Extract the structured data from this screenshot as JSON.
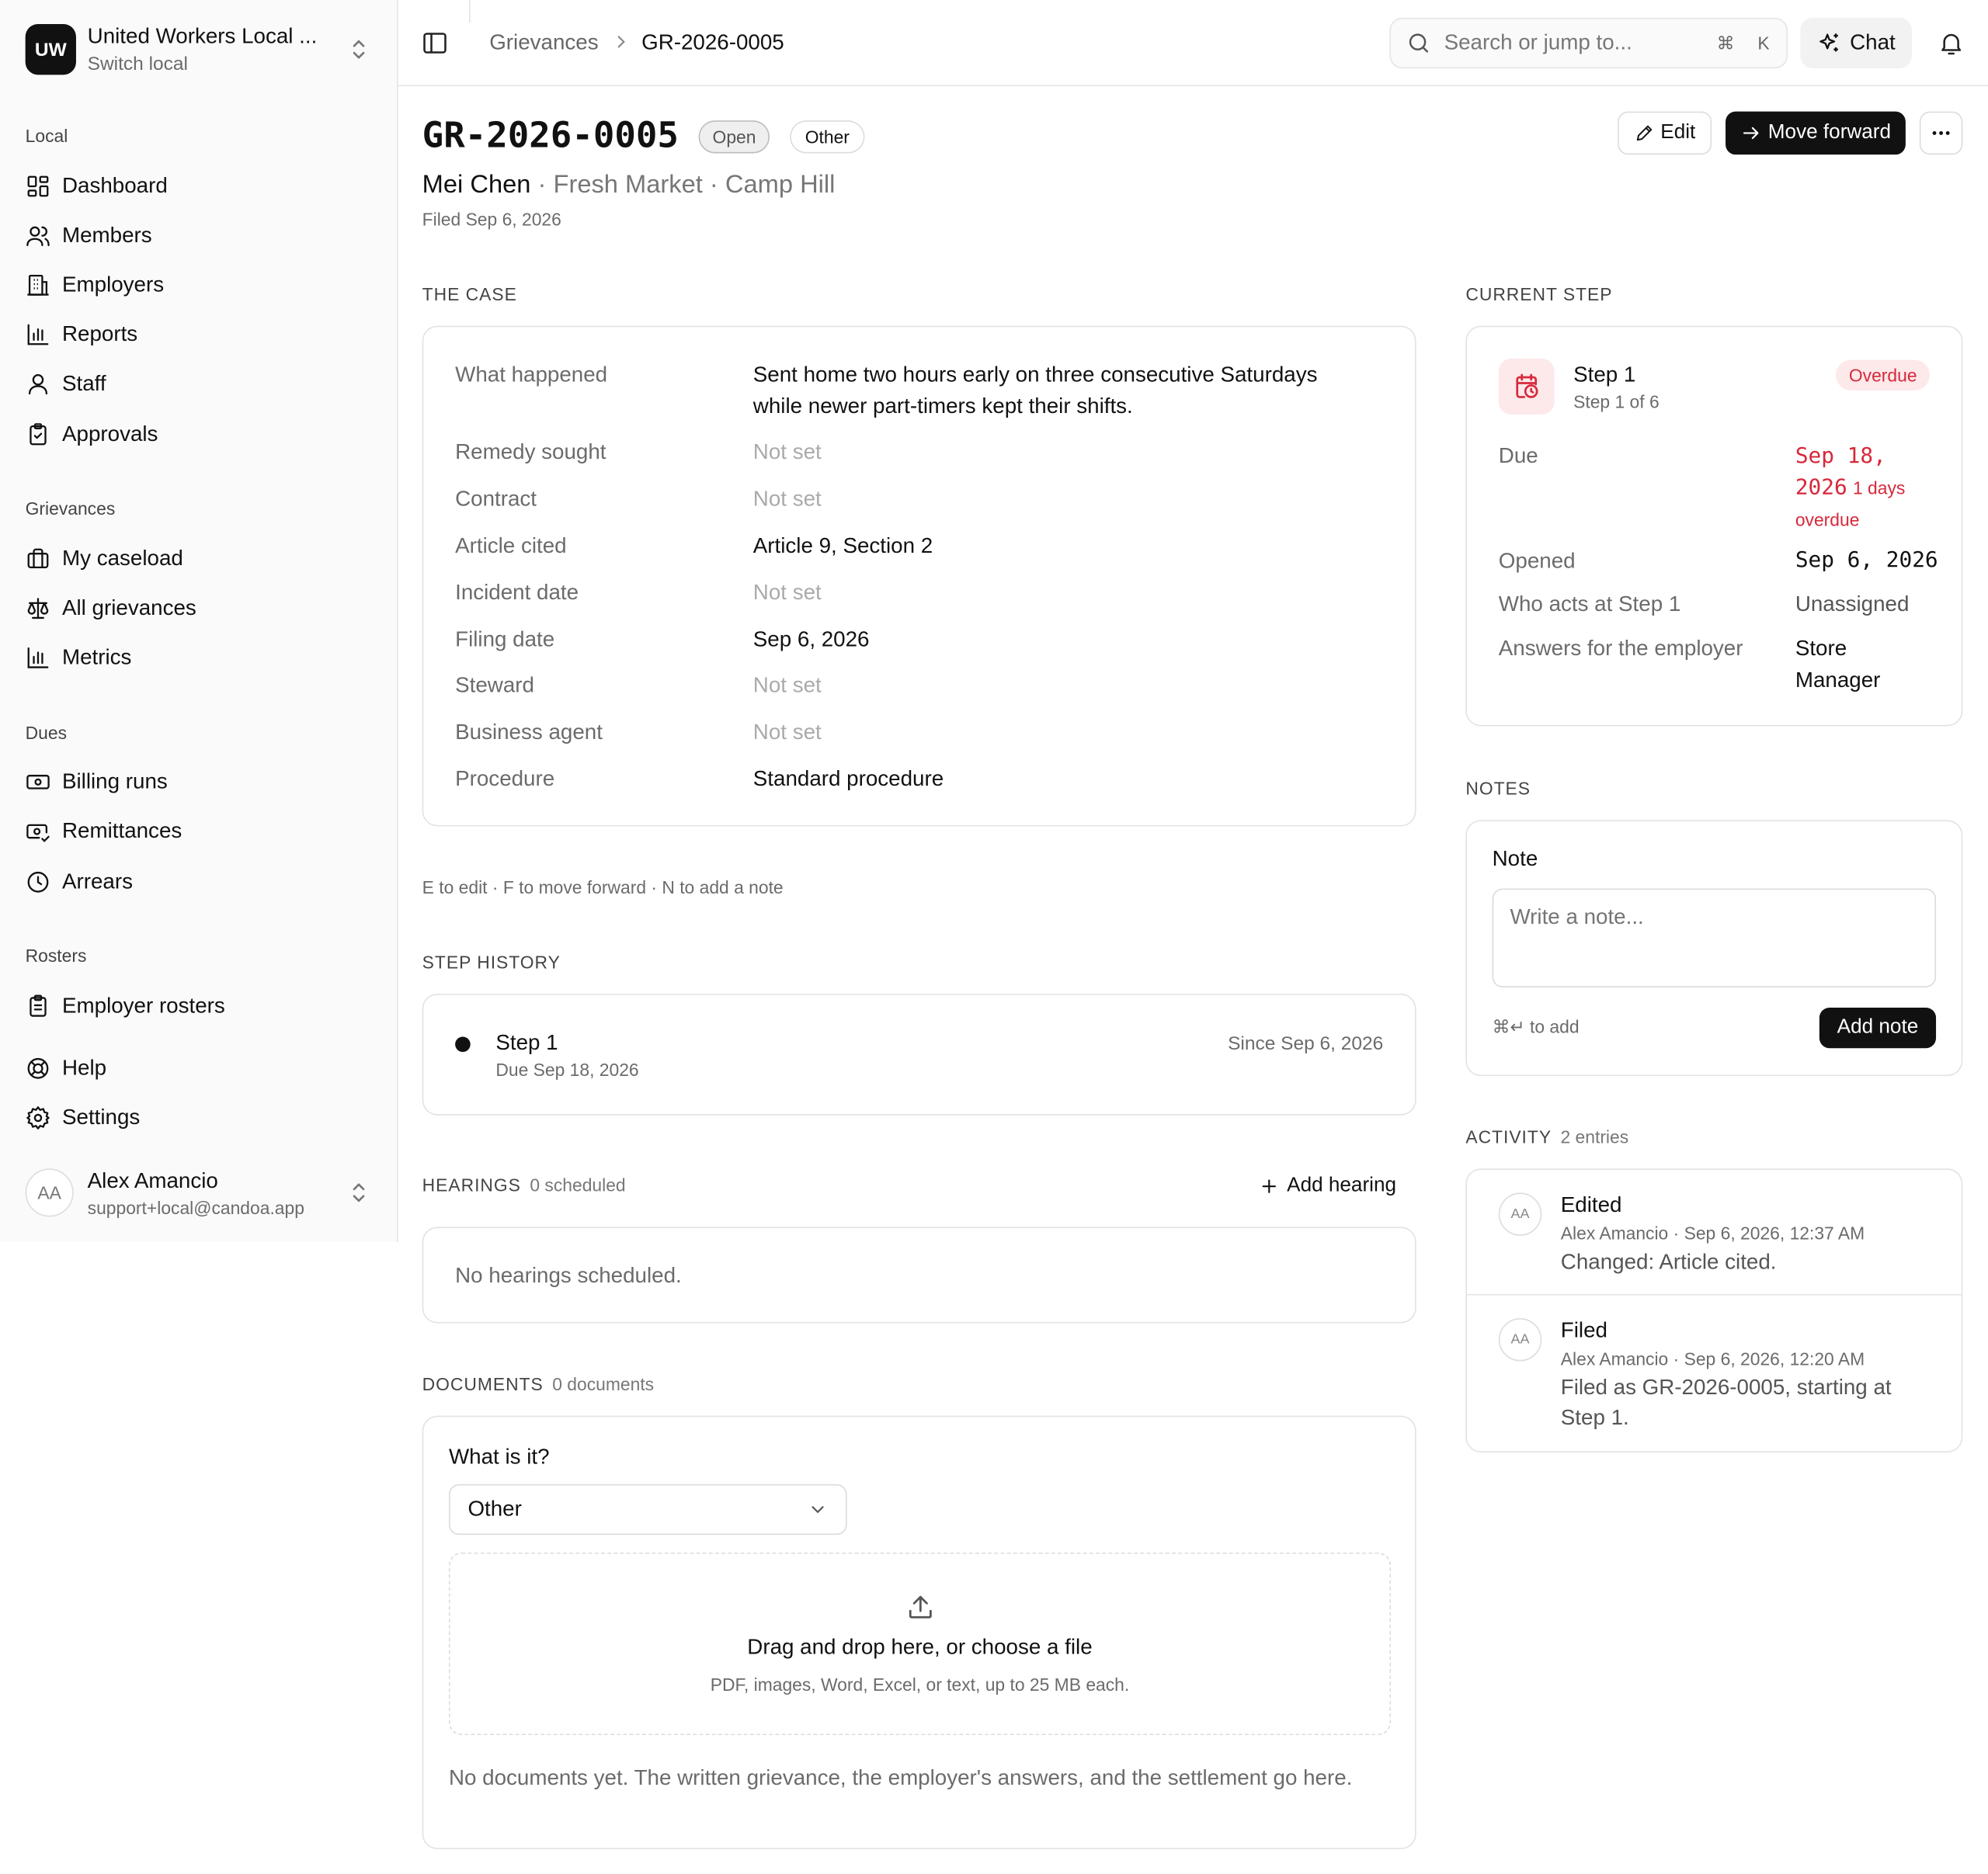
{
  "org": {
    "initials": "UW",
    "name": "United Workers Local ...",
    "switch_label": "Switch local"
  },
  "nav": {
    "groups": [
      {
        "label": "Local",
        "items": [
          "Dashboard",
          "Members",
          "Employers",
          "Reports",
          "Staff",
          "Approvals"
        ]
      },
      {
        "label": "Grievances",
        "items": [
          "My caseload",
          "All grievances",
          "Metrics"
        ]
      },
      {
        "label": "Dues",
        "items": [
          "Billing runs",
          "Remittances",
          "Arrears"
        ]
      },
      {
        "label": "Rosters",
        "items": [
          "Employer rosters"
        ]
      }
    ],
    "footer_items": [
      "Help",
      "Settings"
    ]
  },
  "user": {
    "initials": "AA",
    "name": "Alex Amancio",
    "email": "support+local@candoa.app"
  },
  "topbar": {
    "breadcrumb": [
      "Grievances",
      "GR-2026-0005"
    ],
    "search_placeholder": "Search or jump to...",
    "search_shortcut": [
      "⌘",
      "K"
    ],
    "chat_label": "Chat"
  },
  "header": {
    "title": "GR-2026-0005",
    "status_badge": "Open",
    "type_badge": "Other",
    "member": "Mei Chen",
    "employer": "Fresh Market",
    "location": "Camp Hill",
    "separator": "·",
    "filed": "Filed Sep 6, 2026",
    "edit_label": "Edit",
    "move_label": "Move forward"
  },
  "case": {
    "section_title": "THE CASE",
    "fields": [
      {
        "label": "What happened",
        "value": "Sent home two hours early on three consecutive Saturdays while newer part-timers kept their shifts.",
        "set": true
      },
      {
        "label": "Remedy sought",
        "value": "Not set",
        "set": false
      },
      {
        "label": "Contract",
        "value": "Not set",
        "set": false
      },
      {
        "label": "Article cited",
        "value": "Article 9, Section 2",
        "set": true
      },
      {
        "label": "Incident date",
        "value": "Not set",
        "set": false
      },
      {
        "label": "Filing date",
        "value": "Sep 6, 2026",
        "set": true
      },
      {
        "label": "Steward",
        "value": "Not set",
        "set": false
      },
      {
        "label": "Business agent",
        "value": "Not set",
        "set": false
      },
      {
        "label": "Procedure",
        "value": "Standard procedure",
        "set": true
      }
    ],
    "shortcuts": "E to edit · F to move forward · N to add a note"
  },
  "step_history": {
    "section_title": "STEP HISTORY",
    "items": [
      {
        "step": "Step 1",
        "due": "Due Sep 18, 2026",
        "since": "Since Sep 6, 2026"
      }
    ]
  },
  "hearings": {
    "section_title": "HEARINGS",
    "count": "0 scheduled",
    "add_label": "Add hearing",
    "empty": "No hearings scheduled."
  },
  "documents": {
    "section_title": "DOCUMENTS",
    "count": "0 documents",
    "type_label": "What is it?",
    "type_value": "Other",
    "drop_title": "Drag and drop here, or choose a file",
    "drop_sub": "PDF, images, Word, Excel, or text, up to 25 MB each.",
    "empty": "No documents yet. The written grievance, the employer's answers, and the settlement go here."
  },
  "current_step": {
    "section_title": "CURRENT STEP",
    "name": "Step 1",
    "position": "Step 1 of 6",
    "badge": "Overdue",
    "due_label": "Due",
    "due_date": "Sep 18, 2026",
    "due_overdue": "1 days overdue",
    "rows": [
      {
        "label": "Opened",
        "value": "Sep 6, 2026"
      },
      {
        "label": "Who acts at Step 1",
        "value": "Unassigned"
      },
      {
        "label": "Answers for the employer",
        "value": "Store Manager"
      }
    ],
    "colors": {
      "overdue": "#d6293b",
      "overdue_bg": "#fde8ea"
    }
  },
  "notes": {
    "section_title": "NOTES",
    "label": "Note",
    "placeholder": "Write a note...",
    "hint": "⌘↵ to add",
    "add_label": "Add note"
  },
  "activity": {
    "section_title": "ACTIVITY",
    "count": "2 entries",
    "items": [
      {
        "initials": "AA",
        "title": "Edited",
        "meta": "Alex Amancio · Sep 6, 2026, 12:37 AM",
        "body": "Changed: Article cited."
      },
      {
        "initials": "AA",
        "title": "Filed",
        "meta": "Alex Amancio · Sep 6, 2026, 12:20 AM",
        "body": "Filed as GR-2026-0005, starting at Step 1."
      }
    ]
  }
}
